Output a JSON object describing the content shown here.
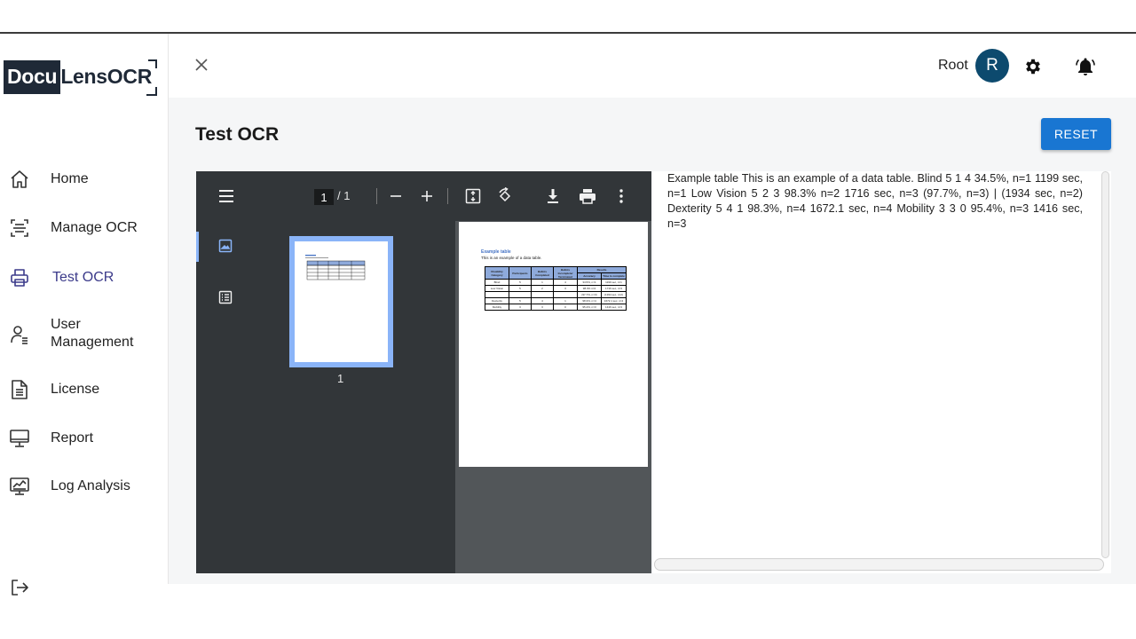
{
  "app": {
    "logo_dark": "Docu",
    "logo_light": "LensOCR"
  },
  "sidebar": {
    "items": [
      {
        "label": "Home",
        "icon": "home-icon"
      },
      {
        "label": "Manage OCR",
        "icon": "scan-icon"
      },
      {
        "label": "Test OCR",
        "icon": "printer-icon",
        "active": true
      },
      {
        "label": "User\nManagement",
        "icon": "user-manage-icon"
      },
      {
        "label": "License",
        "icon": "document-icon"
      },
      {
        "label": "Report",
        "icon": "monitor-icon"
      },
      {
        "label": "Log Analysis",
        "icon": "analytics-icon"
      }
    ],
    "logout_icon": "logout-icon"
  },
  "header": {
    "user_name": "Root",
    "avatar_letter": "R",
    "avatar_color": "#0d4a6e"
  },
  "main": {
    "title": "Test OCR",
    "reset_label": "RESET",
    "accent_color": "#1976d2"
  },
  "viewer": {
    "current_page": "1",
    "total_pages": "/ 1",
    "thumb_label": "1",
    "doc": {
      "title": "Example table",
      "subtitle": "This is an example of a data table.",
      "headers": [
        "Disability Category",
        "Participants",
        "Ballots Completed",
        "Ballots Incomplete/ Terminated",
        "Results"
      ],
      "sub_headers": [
        "Accuracy",
        "Time to complete"
      ],
      "rows": [
        [
          "Blind",
          "5",
          "1",
          "4",
          "34.5%, n=1",
          "1199 sec, n=1"
        ],
        [
          "Low Vision",
          "5",
          "2",
          "3",
          "98.3% n=2",
          "1716 sec, n=3"
        ],
        [
          "",
          "",
          "",
          "",
          "(97.7%, n=3)",
          "(1934 sec, n=2)"
        ],
        [
          "Dexterity",
          "5",
          "4",
          "1",
          "98.3%, n=4",
          "1672.1 sec, n=4"
        ],
        [
          "Mobility",
          "3",
          "3",
          "0",
          "95.4%, n=3",
          "1416 sec, n=3"
        ]
      ]
    }
  },
  "ocr": {
    "text": "Example table This is an example of a data table. Blind 5 1 4 34.5%, n=1 1199 sec, n=1 Low Vision 5 2 3 98.3% n=2 1716 sec, n=3 (97.7%, n=3) | (1934 sec, n=2) Dexterity 5 4 1 98.3%, n=4 1672.1 sec, n=4 Mobility 3 3 0 95.4%, n=3 1416 sec, n=3"
  }
}
